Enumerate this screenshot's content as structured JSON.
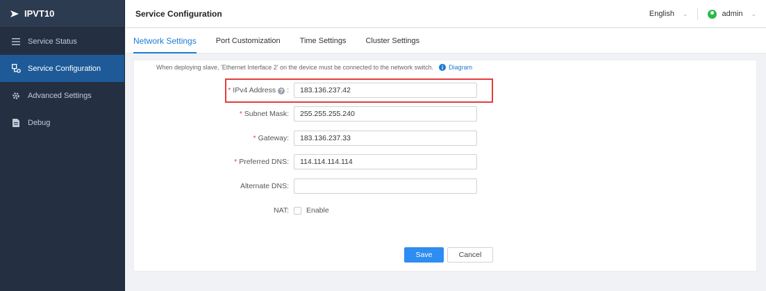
{
  "app": {
    "name": "IPVT10"
  },
  "sidebar": {
    "items": [
      {
        "label": "Service Status",
        "icon": "list-icon",
        "active": false
      },
      {
        "label": "Service Configuration",
        "icon": "config-icon",
        "active": true
      },
      {
        "label": "Advanced Settings",
        "icon": "gear-icon",
        "active": false
      },
      {
        "label": "Debug",
        "icon": "document-icon",
        "active": false
      }
    ]
  },
  "header": {
    "title": "Service Configuration",
    "language": "English",
    "user": "admin"
  },
  "tabs": [
    {
      "label": "Network Settings",
      "active": true
    },
    {
      "label": "Port Customization",
      "active": false
    },
    {
      "label": "Time Settings",
      "active": false
    },
    {
      "label": "Cluster Settings",
      "active": false
    }
  ],
  "form": {
    "notice": "When deploying slave, 'Ethernet Interface 2' on the device must be connected to the network switch.",
    "diagram_link": "Diagram",
    "ipv4": {
      "label": "IPv4 Address",
      "value": "183.136.237.42"
    },
    "subnet": {
      "label": "Subnet Mask:",
      "value": "255.255.255.240"
    },
    "gateway": {
      "label": "Gateway:",
      "value": "183.136.237.33"
    },
    "preferred_dns": {
      "label": "Preferred DNS:",
      "value": "114.114.114.114"
    },
    "alternate_dns": {
      "label": "Alternate DNS:",
      "value": ""
    },
    "nat": {
      "label": "NAT:",
      "option": "Enable",
      "checked": false
    },
    "required_mark": "*",
    "colon": ":",
    "save": "Save",
    "cancel": "Cancel"
  },
  "colors": {
    "accent": "#1a7ad6",
    "sidebar_bg": "#243042",
    "active_nav": "#1e5a97",
    "highlight_box": "#e33b3b",
    "required": "#e0463f"
  }
}
